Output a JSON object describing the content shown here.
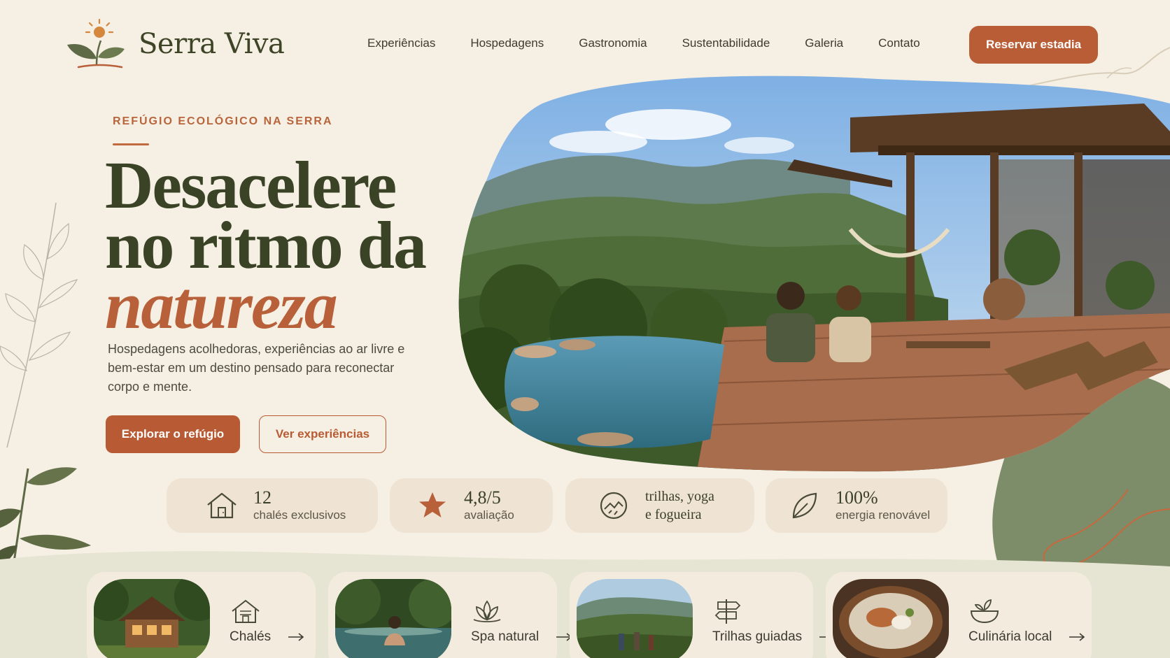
{
  "brand": {
    "name": "Serra Viva"
  },
  "nav": {
    "items": [
      "Experiências",
      "Hospedagens",
      "Gastronomia",
      "Sustentabilidade",
      "Galeria",
      "Contato"
    ],
    "cta": "Reservar estadia"
  },
  "hero": {
    "eyebrow": "REFÚGIO ECOLÓGICO NA SERRA",
    "title_line1": "Desacelere",
    "title_line2": "no ritmo da",
    "title_line3": "natureza",
    "lead": "Hospedagens acolhedoras, experiências ao ar livre e bem-estar em um destino pensado para reconectar corpo e mente.",
    "primary_cta": "Explorar o refúgio",
    "secondary_cta": "Ver experiências"
  },
  "stats": [
    {
      "icon": "house-icon",
      "value": "12",
      "caption": "chalés exclusivos"
    },
    {
      "icon": "star-icon",
      "value": "4,8/5",
      "caption": "avaliação"
    },
    {
      "icon": "trail-globe-icon",
      "line1": "trilhas, yoga",
      "line2": "e fogueira"
    },
    {
      "icon": "leaf-icon",
      "value": "100%",
      "caption": "energia renovável"
    }
  ],
  "cards": [
    {
      "icon": "chalet-icon",
      "label": "Chalés"
    },
    {
      "icon": "lotus-icon",
      "label": "Spa natural"
    },
    {
      "icon": "signpost-icon",
      "label": "Trilhas guiadas"
    },
    {
      "icon": "bowl-icon",
      "label": "Culinária local"
    }
  ],
  "colors": {
    "accent": "#b95d36",
    "olive": "#3a4326",
    "cream": "#f6efe3",
    "sage": "#7d8c69"
  }
}
